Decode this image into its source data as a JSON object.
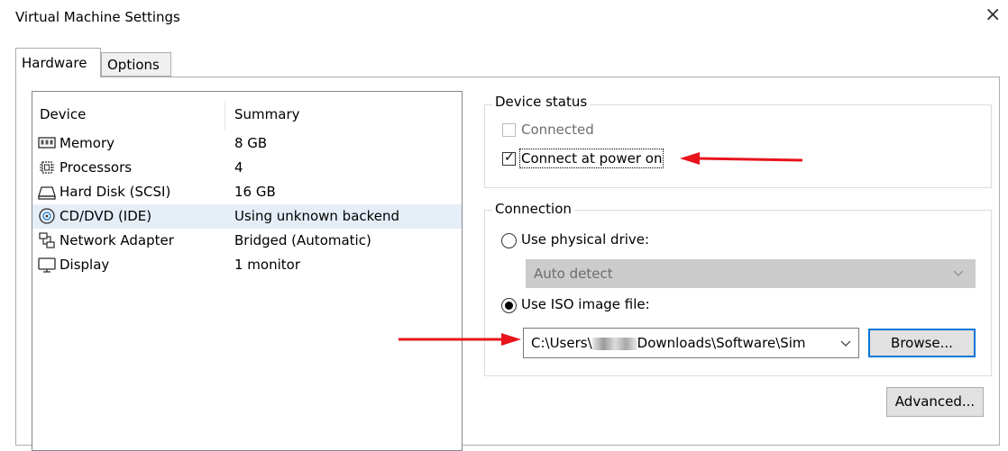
{
  "window": {
    "title": "Virtual Machine Settings",
    "close_glyph": "×"
  },
  "tabs": [
    {
      "label": "Hardware"
    },
    {
      "label": "Options"
    }
  ],
  "device_list": {
    "headers": {
      "device": "Device",
      "summary": "Summary"
    },
    "rows": [
      {
        "icon": "memory-icon",
        "device": "Memory",
        "summary": "8 GB"
      },
      {
        "icon": "processor-icon",
        "device": "Processors",
        "summary": "4"
      },
      {
        "icon": "hard-disk-icon",
        "device": "Hard Disk (SCSI)",
        "summary": "16 GB"
      },
      {
        "icon": "cd-dvd-icon",
        "device": "CD/DVD (IDE)",
        "summary": "Using unknown backend"
      },
      {
        "icon": "network-adapter-icon",
        "device": "Network Adapter",
        "summary": "Bridged (Automatic)"
      },
      {
        "icon": "display-icon",
        "device": "Display",
        "summary": "1 monitor"
      }
    ],
    "selected": "CD/DVD (IDE)"
  },
  "device_status": {
    "label": "Device status",
    "connected": {
      "label": "Connected",
      "checked": false,
      "enabled": false
    },
    "connect_at_power_on": {
      "label": "Connect at power on",
      "checked": true
    }
  },
  "connection": {
    "label": "Connection",
    "physical_drive": {
      "label": "Use physical drive:",
      "selected": false,
      "dropdown_value": "Auto detect"
    },
    "iso_image": {
      "label": "Use ISO image file:",
      "selected": true,
      "path_prefix": "C:\\Users\\",
      "path_suffix": "Downloads\\Software\\Sim"
    },
    "browse_label": "Browse..."
  },
  "advanced_label": "Advanced...",
  "colors": {
    "accent": "#0078d7",
    "arrow": "#e8141c",
    "selection": "#e5eef7"
  }
}
